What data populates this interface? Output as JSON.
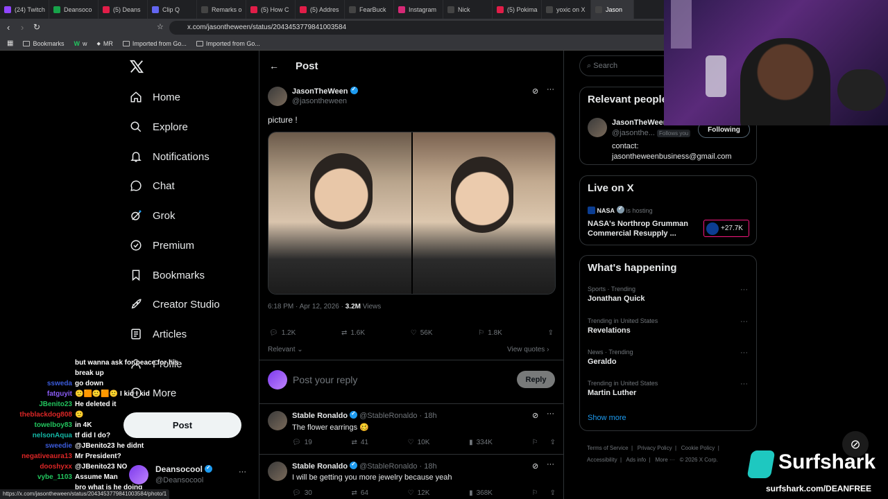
{
  "browser": {
    "tabs": [
      {
        "label": "(24) Twitch",
        "color": "#9146ff"
      },
      {
        "label": "Deansoco",
        "color": "#17a34a"
      },
      {
        "label": "(5) Deans",
        "color": "#e11d48"
      },
      {
        "label": "Clip Q",
        "color": "#6366f1"
      },
      {
        "label": "Remarks o",
        "color": "#444"
      },
      {
        "label": "(5) How C",
        "color": "#e11d48"
      },
      {
        "label": "(5) Addres",
        "color": "#e11d48"
      },
      {
        "label": "FearBuck",
        "color": "#444"
      },
      {
        "label": "Instagram",
        "color": "#d62976"
      },
      {
        "label": "Nick",
        "color": "#444"
      },
      {
        "label": "(5) Pokima",
        "color": "#e11d48"
      },
      {
        "label": "yoxic on X",
        "color": "#444"
      },
      {
        "label": "Jason",
        "color": "#444"
      }
    ],
    "url": "x.com/jasontheween/status/2043453779841003584",
    "bookmarks": [
      "Bookmarks",
      "w",
      "MR",
      "Imported from Go...",
      "Imported from Go..."
    ],
    "status_url": "https://x.com/jasontheween/status/2043453779841003584/photo/1"
  },
  "nav": {
    "items": [
      "Home",
      "Explore",
      "Notifications",
      "Chat",
      "Grok",
      "Premium",
      "Bookmarks",
      "Creator Studio",
      "Articles",
      "Profile",
      "More"
    ],
    "post_label": "Post",
    "account_name": "Deansocool",
    "account_handle": "@Deansocool"
  },
  "post": {
    "header": "Post",
    "author_name": "JasonTheWeen",
    "author_handle": "@jasontheween",
    "text": "picture !",
    "timestamp": "6:18 PM · Apr 12, 2026 ·",
    "views_count": "3.2M",
    "views_label": "Views",
    "replies": "1.2K",
    "reposts": "1.6K",
    "likes": "56K",
    "bookmarks": "1.8K",
    "sort_label": "Relevant",
    "view_quotes": "View quotes",
    "reply_placeholder": "Post your reply",
    "reply_button": "Reply"
  },
  "replies": [
    {
      "name": "Stable Ronaldo",
      "handle": "@StableRonaldo",
      "time": "· 18h",
      "text": "The flower earrings 🥴",
      "replies": "19",
      "reposts": "41",
      "likes": "10K",
      "views": "334K"
    },
    {
      "name": "Stable Ronaldo",
      "handle": "@StableRonaldo",
      "time": "· 18h",
      "text": "I will be getting you more jewelry because yeah",
      "replies": "30",
      "reposts": "64",
      "likes": "12K",
      "views": "368K"
    }
  ],
  "sidebar": {
    "search_placeholder": "Search",
    "relevant_title": "Relevant people",
    "relevant_name": "JasonTheWeen",
    "relevant_handle": "@jasonthe...",
    "follows_you": "Follows you",
    "following_button": "Following",
    "bio_line1": "contact:",
    "bio_line2": "jasontheweenbusiness@gmail.com",
    "live_title": "Live on X",
    "live_host": "NASA",
    "live_hosting": "is hosting",
    "live_text": "NASA's Northrop Grumman Commercial Resupply ...",
    "live_count": "+27.7K",
    "happening_title": "What's happening",
    "trends": [
      {
        "meta": "Sports · Trending",
        "name": "Jonathan Quick"
      },
      {
        "meta": "Trending in United States",
        "name": "Revelations"
      },
      {
        "meta": "News · Trending",
        "name": "Geraldo"
      },
      {
        "meta": "Trending in United States",
        "name": "Martin Luther"
      }
    ],
    "show_more": "Show more",
    "footer": [
      "Terms of Service",
      "Privacy Policy",
      "Cookie Policy",
      "Accessibility",
      "Ads info",
      "More ···",
      "© 2026 X Corp."
    ]
  },
  "chat": [
    {
      "user": "",
      "msg": "but wanna ask for peace for his",
      "color": "#fff"
    },
    {
      "user": "",
      "msg": "break up",
      "color": "#fff"
    },
    {
      "user": "ssweda",
      "msg": "go down",
      "color": "#3b5bdb"
    },
    {
      "user": "fatguyit",
      "msg": "🙂🟧🙂🟧🙂 I kid I kid",
      "color": "#8b5cf6"
    },
    {
      "user": "JBenito23",
      "msg": "He deleted it",
      "color": "#22c55e"
    },
    {
      "user": "theblackdog808",
      "msg": "🙂",
      "color": "#dc2626"
    },
    {
      "user": "towelboy83",
      "msg": "in 4K",
      "color": "#22c55e"
    },
    {
      "user": "nelsonAqua",
      "msg": "tf did I do?",
      "color": "#14b8a6"
    },
    {
      "user": "sweedie",
      "msg": "@JBenito23 he didnt",
      "color": "#3b5bdb"
    },
    {
      "user": "negativeaura13",
      "msg": "Mr President?",
      "color": "#dc2626"
    },
    {
      "user": "dooshyxx",
      "msg": "@JBenito23 NO",
      "color": "#dc2626"
    },
    {
      "user": "vybe_1103",
      "msg": "Assume Man",
      "color": "#22c55e"
    },
    {
      "user": "",
      "msg": "bro what is he doing",
      "color": "#fff"
    }
  ],
  "sponsor": {
    "brand": "Surfshark",
    "url": "surfshark.com/DEANFREE"
  }
}
